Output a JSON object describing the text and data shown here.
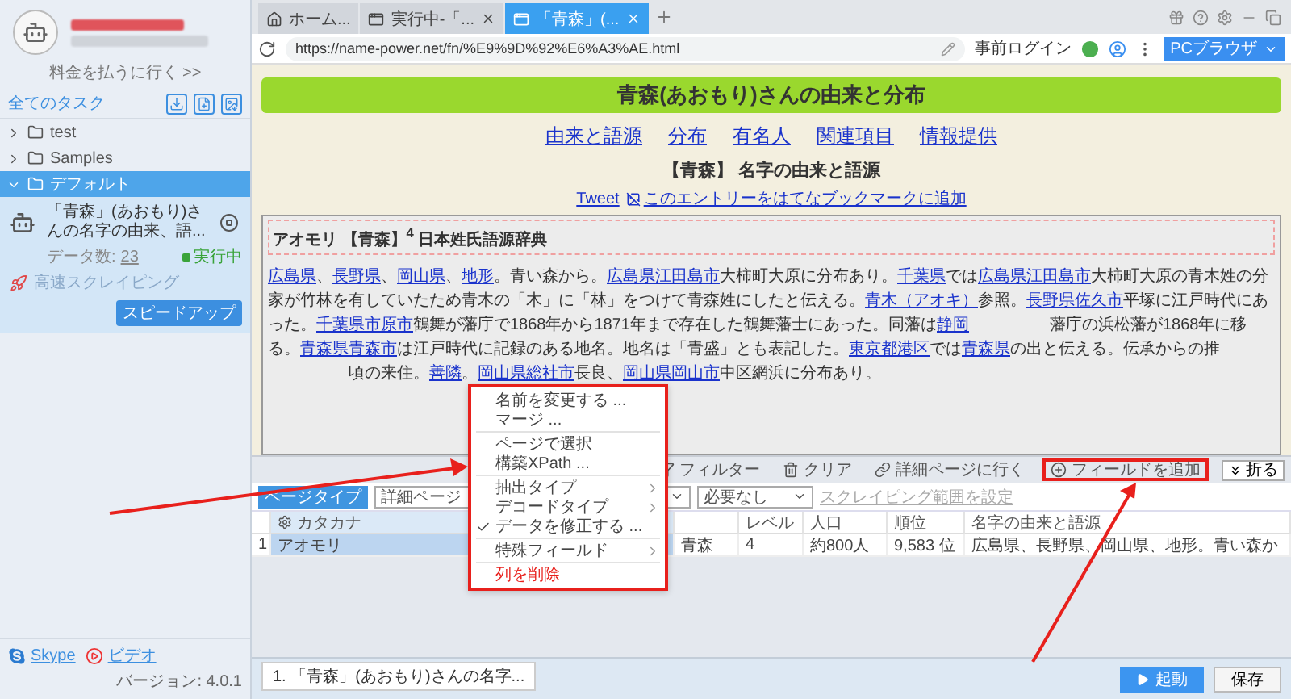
{
  "sidebar": {
    "upgrade_link": "料金を払うに行く >>",
    "section_title": "全てのタスク",
    "tree": [
      {
        "label": "test",
        "expanded": false,
        "selected": false
      },
      {
        "label": "Samples",
        "expanded": false,
        "selected": false
      },
      {
        "label": "デフォルト",
        "expanded": true,
        "selected": true,
        "children": [
          {
            "title": "「青森」(あおもり)さんの名字の由来、語...",
            "data_count_label": "データ数:",
            "data_count": "23",
            "status": "実行中",
            "mode": "高速スクレイピング",
            "action": "スピードアップ"
          }
        ]
      }
    ],
    "version": "バージョン: 4.0.1",
    "links": [
      {
        "label": "Skype",
        "kind": "skype"
      },
      {
        "label": "ビデオ",
        "kind": "video"
      }
    ]
  },
  "browser": {
    "tabs": [
      {
        "label": "ホーム...",
        "kind": "home",
        "selected": false
      },
      {
        "label": "実行中-「...",
        "kind": "page",
        "selected": false
      },
      {
        "label": "「青森」(...",
        "kind": "page",
        "selected": true
      }
    ],
    "url": "https://name-power.net/fn/%E9%9D%92%E6%A3%AE.html",
    "login": "事前ログイン",
    "mode_button": "PCブラウザ"
  },
  "page": {
    "heading": "青森(あおもり)さんの由来と分布",
    "nav": [
      "由来と語源",
      "分布",
      "有名人",
      "関連項目",
      "情報提供"
    ],
    "subheading": "【青森】 名字の由来と語源",
    "tweet": "Tweet",
    "bookmark_alt": "このエントリーをはてなブックマークに追加",
    "entry_title": "アオモリ 【青森】$^{4}$ 日本姓氏語源辞典",
    "paragraph": [
      {
        "kind": "link",
        "text": "広島県"
      },
      {
        "kind": "text",
        "text": "、"
      },
      {
        "kind": "link",
        "text": "長野県"
      },
      {
        "kind": "text",
        "text": "、"
      },
      {
        "kind": "link",
        "text": "岡山県"
      },
      {
        "kind": "text",
        "text": "、"
      },
      {
        "kind": "link",
        "text": "地形"
      },
      {
        "kind": "text",
        "text": "。青い森から。"
      },
      {
        "kind": "link",
        "text": "広島県江田島市"
      },
      {
        "kind": "text",
        "text": "大柿町大原に分布あり。"
      },
      {
        "kind": "link",
        "text": "千葉県"
      },
      {
        "kind": "text",
        "text": "では"
      },
      {
        "kind": "link",
        "text": "広島県江田島市"
      },
      {
        "kind": "text",
        "text": "大柿町大原の青木姓の分家が竹林を有していたため青木の「木」に「林」をつけて青森姓にしたと伝える。"
      },
      {
        "kind": "link",
        "text": "青木（アオキ）"
      },
      {
        "kind": "text",
        "text": "参照。"
      },
      {
        "kind": "link",
        "text": "長野県佐久市"
      },
      {
        "kind": "text",
        "text": "平塚に江戸時代にあった。"
      },
      {
        "kind": "link",
        "text": "千葉県市原市"
      },
      {
        "kind": "text",
        "text": "鶴舞が藩庁で1868年から1871年まで存在した鶴舞藩士にあった。同藩は"
      },
      {
        "kind": "link",
        "text": "静岡"
      },
      {
        "kind": "gap"
      },
      {
        "kind": "text",
        "text": "藩庁の浜松藩が1868年に移る。"
      },
      {
        "kind": "link",
        "text": "青森県青森市"
      },
      {
        "kind": "text",
        "text": "は江戸時代に記録のある地名。地名は「青盛」とも表記した。"
      },
      {
        "kind": "link",
        "text": "東京都港区"
      },
      {
        "kind": "text",
        "text": "では"
      },
      {
        "kind": "link",
        "text": "青森県"
      },
      {
        "kind": "text",
        "text": "の出と伝える。伝承からの推"
      },
      {
        "kind": "gap"
      },
      {
        "kind": "text",
        "text": "頃の来住。"
      },
      {
        "kind": "link",
        "text": "善隣"
      },
      {
        "kind": "text",
        "text": "。"
      },
      {
        "kind": "link",
        "text": "岡山県総社市"
      },
      {
        "kind": "text",
        "text": "長良、"
      },
      {
        "kind": "link",
        "text": "岡山県岡山市"
      },
      {
        "kind": "text",
        "text": "中区網浜に分布あり。"
      }
    ]
  },
  "context_menu": {
    "groups": [
      [
        {
          "label": "名前を変更する ...",
          "kind": "action",
          "checked": false
        },
        {
          "label": "マージ ...",
          "kind": "action",
          "checked": false
        }
      ],
      [
        {
          "label": "ページで選択",
          "kind": "action",
          "checked": false
        },
        {
          "label": "構築XPath ...",
          "kind": "action",
          "checked": false
        }
      ],
      [
        {
          "label": "抽出タイプ",
          "kind": "submenu",
          "checked": false
        },
        {
          "label": "デコードタイプ",
          "kind": "submenu",
          "checked": false
        },
        {
          "label": "データを修正する ...",
          "kind": "action",
          "checked": true
        }
      ],
      [
        {
          "label": "特殊フィールド",
          "kind": "submenu",
          "checked": false
        }
      ],
      [
        {
          "label": "列を削除",
          "kind": "danger",
          "checked": false
        }
      ]
    ]
  },
  "bottom_panel": {
    "actions": [
      {
        "label": "フィルター",
        "kind": "filter",
        "highlighted": false
      },
      {
        "label": "クリア",
        "kind": "clear",
        "highlighted": false
      },
      {
        "label": "詳細ページに行く",
        "kind": "link",
        "highlighted": false
      },
      {
        "label": "フィールドを追加",
        "kind": "add",
        "highlighted": true
      }
    ],
    "collapse": "折る",
    "page_type_tab": "ページタイプ",
    "page_select": "詳細ページ",
    "need_select": "必要なし",
    "range_link": "スクレイピング範囲を設定",
    "columns": [
      {
        "label": "カタカナ",
        "selected": true
      },
      {
        "selected": false
      },
      {
        "label": "レベル",
        "selected": false
      },
      {
        "label": "人口",
        "selected": false
      },
      {
        "label": "順位",
        "selected": false
      },
      {
        "label": "名字の由来と語源",
        "selected": false
      }
    ],
    "rows": [
      {
        "index": "1",
        "cells": [
          "アオモリ",
          "青森",
          "4",
          "約800人",
          "9,583 位",
          "広島県、長野県、岡山県、地形。青い森か"
        ]
      }
    ]
  },
  "footer": {
    "run_tabs": [
      "1. 「青森」(あおもり)さんの名字..."
    ],
    "start": "起動",
    "save": "保存"
  }
}
